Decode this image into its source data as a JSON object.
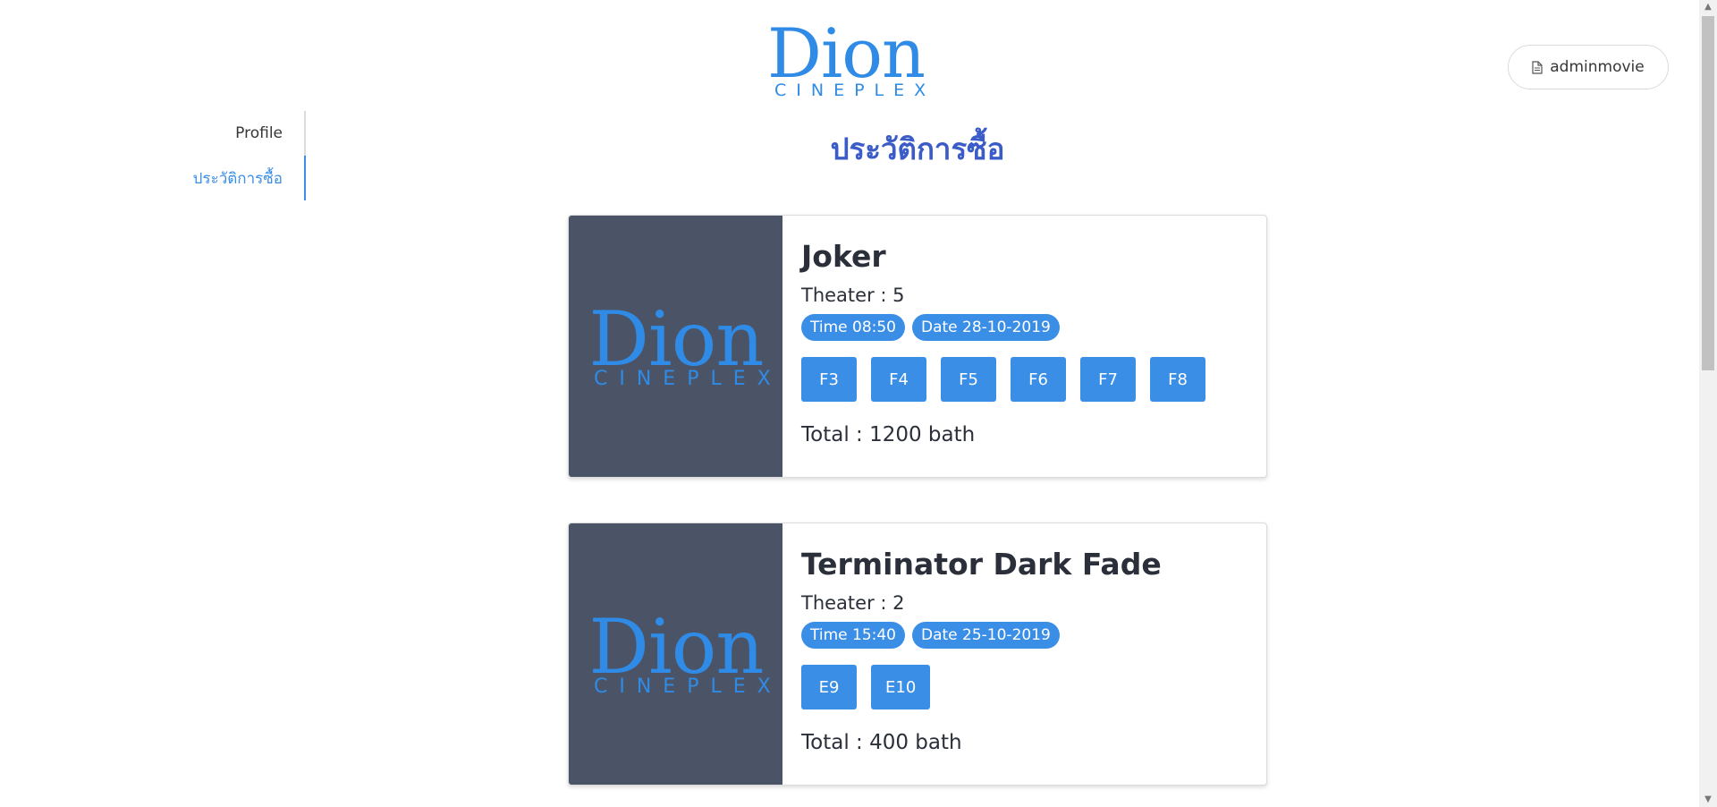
{
  "header": {
    "logo_word": "Dion",
    "logo_sub": "CINEPLEX",
    "user_button_label": "adminmovie"
  },
  "sidebar": {
    "items": [
      {
        "label": "Profile",
        "active": false
      },
      {
        "label": "ประวัติการซื้อ",
        "active": true
      }
    ]
  },
  "main": {
    "title": "ประวัติการซื้อ",
    "orders": [
      {
        "poster_word": "Dion",
        "poster_sub": "CINEPLEX",
        "movie": "Joker",
        "theater": "Theater : 5",
        "time": "Time 08:50",
        "date": "Date 28-10-2019",
        "seats": [
          "F3",
          "F4",
          "F5",
          "F6",
          "F7",
          "F8"
        ],
        "total": "Total : 1200 bath"
      },
      {
        "poster_word": "Dion",
        "poster_sub": "CINEPLEX",
        "movie": "Terminator Dark Fade",
        "theater": "Theater : 2",
        "time": "Time 15:40",
        "date": "Date 25-10-2019",
        "seats": [
          "E9",
          "E10"
        ],
        "total": "Total : 400 bath"
      }
    ]
  },
  "colors": {
    "accent": "#3a8ee6",
    "title": "#3b5cc8",
    "poster_bg": "#4a5466",
    "logo": "#2f8be6"
  },
  "icons": {
    "user_button_icon": "document-icon"
  }
}
